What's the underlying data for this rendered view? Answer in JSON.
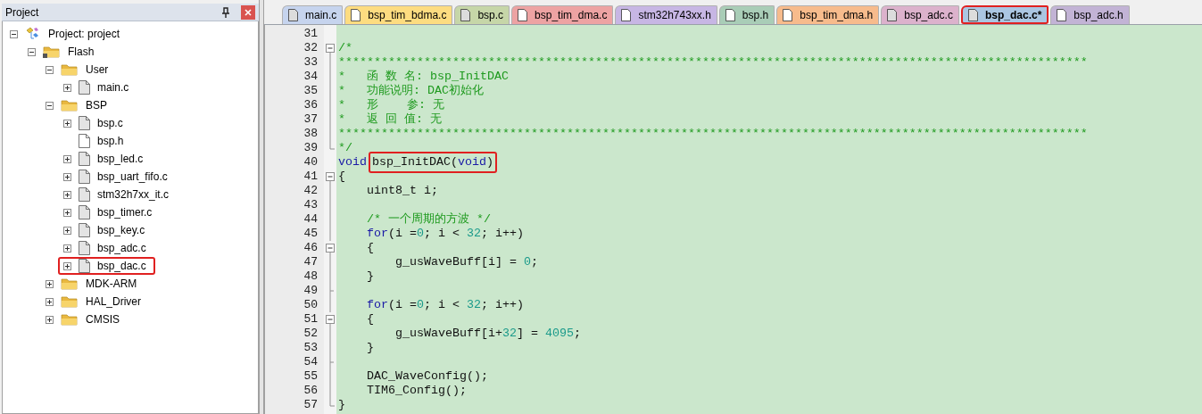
{
  "project_panel": {
    "title": "Project",
    "tree": [
      {
        "label": "Project: project",
        "kind": "project",
        "expanded": true,
        "marked": false,
        "children": [
          {
            "label": "Flash",
            "kind": "target",
            "expanded": true,
            "marked": false,
            "children": [
              {
                "label": "User",
                "kind": "folder",
                "expanded": true,
                "marked": false,
                "children": [
                  {
                    "label": "main.c",
                    "kind": "file",
                    "expanded": false,
                    "marked": false
                  }
                ]
              },
              {
                "label": "BSP",
                "kind": "folder",
                "expanded": true,
                "marked": false,
                "children": [
                  {
                    "label": "bsp.c",
                    "kind": "file",
                    "expanded": false,
                    "marked": false
                  },
                  {
                    "label": "bsp.h",
                    "kind": "header",
                    "marked": false
                  },
                  {
                    "label": "bsp_led.c",
                    "kind": "file",
                    "expanded": false,
                    "marked": false
                  },
                  {
                    "label": "bsp_uart_fifo.c",
                    "kind": "file",
                    "expanded": false,
                    "marked": false
                  },
                  {
                    "label": "stm32h7xx_it.c",
                    "kind": "file",
                    "expanded": false,
                    "marked": false
                  },
                  {
                    "label": "bsp_timer.c",
                    "kind": "file",
                    "expanded": false,
                    "marked": false
                  },
                  {
                    "label": "bsp_key.c",
                    "kind": "file",
                    "expanded": false,
                    "marked": false
                  },
                  {
                    "label": "bsp_adc.c",
                    "kind": "file",
                    "expanded": false,
                    "marked": false
                  },
                  {
                    "label": "bsp_dac.c",
                    "kind": "file",
                    "expanded": false,
                    "marked": true
                  }
                ]
              },
              {
                "label": "MDK-ARM",
                "kind": "folder",
                "expanded": false,
                "marked": false
              },
              {
                "label": "HAL_Driver",
                "kind": "folder",
                "expanded": false,
                "marked": false
              },
              {
                "label": "CMSIS",
                "kind": "folder",
                "expanded": false,
                "marked": false
              }
            ]
          }
        ]
      }
    ]
  },
  "tabs": [
    {
      "label": "main.c",
      "color": "#c6d4ee",
      "kind": "source",
      "selected": false,
      "marked": false
    },
    {
      "label": "bsp_tim_bdma.c",
      "color": "#fddc80",
      "kind": "plain",
      "selected": false,
      "marked": false
    },
    {
      "label": "bsp.c",
      "color": "#c6d6a8",
      "kind": "source",
      "selected": false,
      "marked": false
    },
    {
      "label": "bsp_tim_dma.c",
      "color": "#eda3a3",
      "kind": "plain",
      "selected": false,
      "marked": false
    },
    {
      "label": "stm32h743xx.h",
      "color": "#c7b6e4",
      "kind": "plain",
      "selected": false,
      "marked": false
    },
    {
      "label": "bsp.h",
      "color": "#a9cdb7",
      "kind": "plain",
      "selected": false,
      "marked": false
    },
    {
      "label": "bsp_tim_dma.h",
      "color": "#f7bb8c",
      "kind": "plain",
      "selected": false,
      "marked": false
    },
    {
      "label": "bsp_adc.c",
      "color": "#dcb2cc",
      "kind": "source",
      "selected": false,
      "marked": false
    },
    {
      "label": "bsp_dac.c*",
      "color": "#abc6e2",
      "kind": "source",
      "selected": true,
      "marked": true
    },
    {
      "label": "bsp_adc.h",
      "color": "#c2b3d5",
      "kind": "plain",
      "selected": false,
      "marked": false
    }
  ],
  "editor": {
    "lines": [
      {
        "number": "31",
        "kind": "plain"
      },
      {
        "number": "32",
        "kind": "fold_open",
        "segments": [
          {
            "kind": "comment",
            "text": "/*"
          }
        ]
      },
      {
        "number": "33",
        "kind": "fold_line",
        "segments": [
          {
            "kind": "comment",
            "text": "*********************************************************************************************************"
          }
        ]
      },
      {
        "number": "34",
        "kind": "fold_line",
        "segments": [
          {
            "kind": "comment",
            "text": "*   函 数 名: bsp_InitDAC"
          }
        ]
      },
      {
        "number": "35",
        "kind": "fold_line",
        "segments": [
          {
            "kind": "comment",
            "text": "*   功能说明: DAC初始化"
          }
        ]
      },
      {
        "number": "36",
        "kind": "fold_line",
        "segments": [
          {
            "kind": "comment",
            "text": "*   形    参: 无"
          }
        ]
      },
      {
        "number": "37",
        "kind": "fold_line",
        "segments": [
          {
            "kind": "comment",
            "text": "*   返 回 值: 无"
          }
        ]
      },
      {
        "number": "38",
        "kind": "fold_line",
        "segments": [
          {
            "kind": "comment",
            "text": "*********************************************************************************************************"
          }
        ]
      },
      {
        "number": "39",
        "kind": "fold_end",
        "segments": [
          {
            "kind": "comment",
            "text": "*/"
          }
        ]
      },
      {
        "number": "40",
        "kind": "plain",
        "segments": [
          {
            "kind": "keyword",
            "text": "void"
          },
          {
            "kind": "box",
            "segments": [
              {
                "kind": "plain",
                "text": "bsp_InitDAC("
              },
              {
                "kind": "keyword",
                "text": "void"
              },
              {
                "kind": "plain",
                "text": ")"
              }
            ]
          }
        ]
      },
      {
        "number": "41",
        "kind": "fold_open",
        "segments": [
          {
            "kind": "plain",
            "text": "{"
          }
        ]
      },
      {
        "number": "42",
        "kind": "fold_line",
        "segments": [
          {
            "kind": "plain",
            "text": "    uint8_t i;"
          }
        ]
      },
      {
        "number": "43",
        "kind": "fold_line"
      },
      {
        "number": "44",
        "kind": "fold_line",
        "segments": [
          {
            "kind": "comment",
            "text": "    /* 一个周期的方波 */"
          }
        ]
      },
      {
        "number": "45",
        "kind": "fold_line",
        "segments": [
          {
            "kind": "keyword",
            "text": "    for"
          },
          {
            "kind": "plain",
            "text": "(i ="
          },
          {
            "kind": "number",
            "text": "0"
          },
          {
            "kind": "plain",
            "text": "; i < "
          },
          {
            "kind": "number",
            "text": "32"
          },
          {
            "kind": "plain",
            "text": "; i++)"
          }
        ]
      },
      {
        "number": "46",
        "kind": "fold_open",
        "segments": [
          {
            "kind": "plain",
            "text": "    {"
          }
        ]
      },
      {
        "number": "47",
        "kind": "fold_line",
        "segments": [
          {
            "kind": "plain",
            "text": "        g_usWaveBuff[i] = "
          },
          {
            "kind": "number",
            "text": "0"
          },
          {
            "kind": "plain",
            "text": ";"
          }
        ]
      },
      {
        "number": "48",
        "kind": "fold_line",
        "segments": [
          {
            "kind": "plain",
            "text": "    }"
          }
        ]
      },
      {
        "number": "49",
        "kind": "fold_tick"
      },
      {
        "number": "50",
        "kind": "fold_line",
        "segments": [
          {
            "kind": "keyword",
            "text": "    for"
          },
          {
            "kind": "plain",
            "text": "(i ="
          },
          {
            "kind": "number",
            "text": "0"
          },
          {
            "kind": "plain",
            "text": "; i < "
          },
          {
            "kind": "number",
            "text": "32"
          },
          {
            "kind": "plain",
            "text": "; i++)"
          }
        ]
      },
      {
        "number": "51",
        "kind": "fold_open",
        "segments": [
          {
            "kind": "plain",
            "text": "    {"
          }
        ]
      },
      {
        "number": "52",
        "kind": "fold_line",
        "segments": [
          {
            "kind": "plain",
            "text": "        g_usWaveBuff[i+"
          },
          {
            "kind": "number",
            "text": "32"
          },
          {
            "kind": "plain",
            "text": "] = "
          },
          {
            "kind": "number",
            "text": "4095"
          },
          {
            "kind": "plain",
            "text": ";"
          }
        ]
      },
      {
        "number": "53",
        "kind": "fold_line",
        "segments": [
          {
            "kind": "plain",
            "text": "    }"
          }
        ]
      },
      {
        "number": "54",
        "kind": "fold_tick"
      },
      {
        "number": "55",
        "kind": "fold_line",
        "segments": [
          {
            "kind": "plain",
            "text": "    DAC_WaveConfig();"
          }
        ]
      },
      {
        "number": "56",
        "kind": "fold_line",
        "segments": [
          {
            "kind": "plain",
            "text": "    TIM6_Config();"
          }
        ]
      },
      {
        "number": "57",
        "kind": "fold_end",
        "segments": [
          {
            "kind": "plain",
            "text": "}"
          }
        ]
      }
    ]
  }
}
